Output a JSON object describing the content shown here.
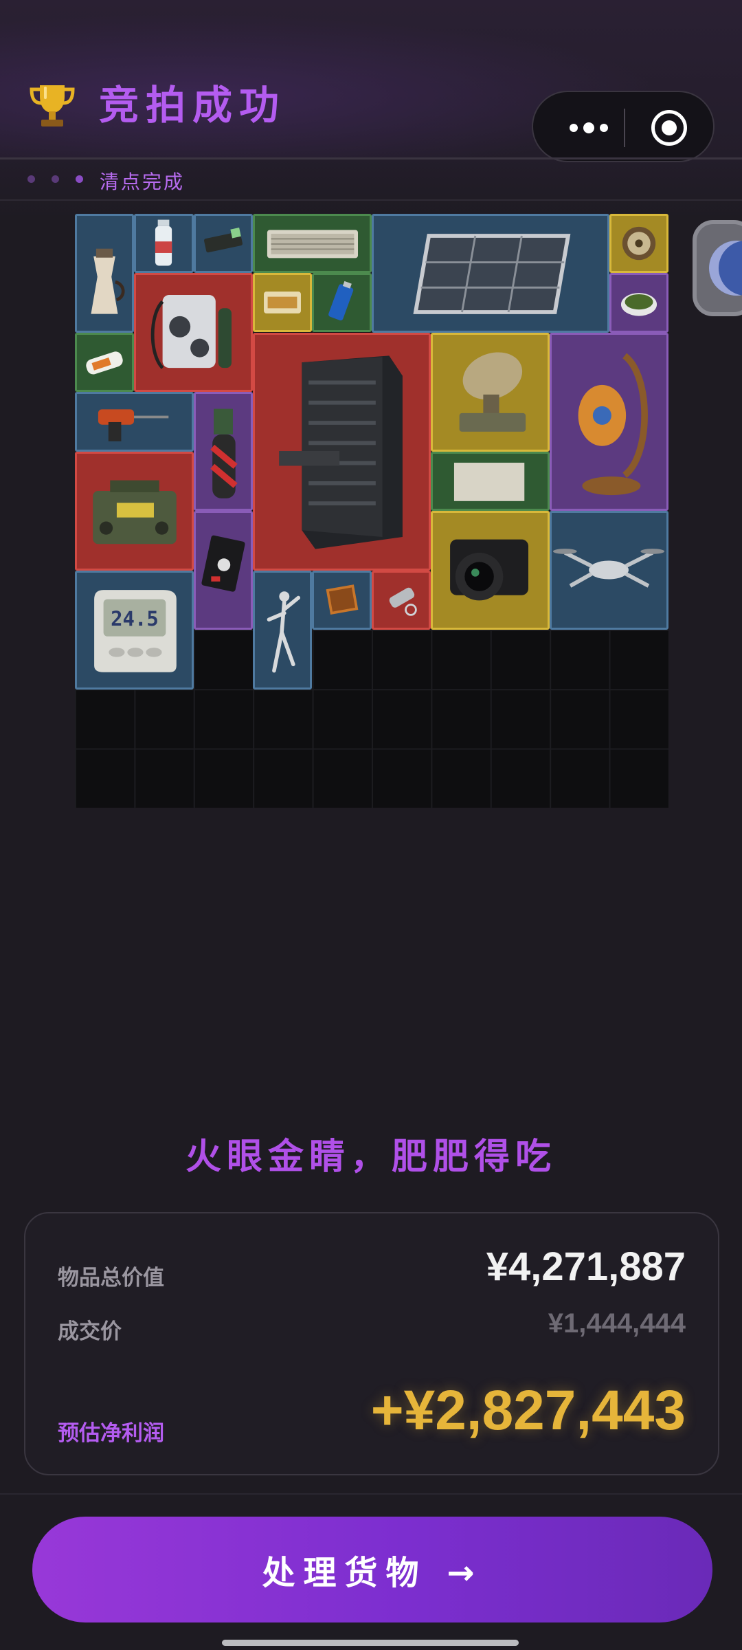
{
  "header": {
    "title": "竞拍成功",
    "status": "清点完成",
    "icons": {
      "trophy": "trophy-icon",
      "more": "more-icon",
      "target": "target-icon"
    }
  },
  "grid": {
    "items": [
      {
        "name": "moka-pot",
        "color": "blue"
      },
      {
        "name": "water-bottle",
        "color": "blue"
      },
      {
        "name": "usb-drive",
        "color": "blue"
      },
      {
        "name": "keyboard",
        "color": "green"
      },
      {
        "name": "solar-panel",
        "color": "blue"
      },
      {
        "name": "pocket-watch",
        "color": "yellow"
      },
      {
        "name": "generator",
        "color": "red"
      },
      {
        "name": "cookie-tin",
        "color": "yellow"
      },
      {
        "name": "battery",
        "color": "green"
      },
      {
        "name": "herb-bowl",
        "color": "purple"
      },
      {
        "name": "pill-bottle",
        "color": "green"
      },
      {
        "name": "server-rack",
        "color": "red"
      },
      {
        "name": "radar-dish",
        "color": "yellow"
      },
      {
        "name": "lantern",
        "color": "purple"
      },
      {
        "name": "power-drill",
        "color": "blue"
      },
      {
        "name": "blowtorch",
        "color": "purple"
      },
      {
        "name": "military-radio",
        "color": "red"
      },
      {
        "name": "old-document",
        "color": "green"
      },
      {
        "name": "snack-pack",
        "color": "purple"
      },
      {
        "name": "camera",
        "color": "yellow"
      },
      {
        "name": "drone",
        "color": "blue"
      },
      {
        "name": "thermometer",
        "color": "blue"
      },
      {
        "name": "dancer-figurine",
        "color": "blue"
      },
      {
        "name": "matchbox",
        "color": "blue"
      },
      {
        "name": "flashlight",
        "color": "red"
      }
    ],
    "thermometer_reading": "24.5"
  },
  "quote": "火眼金睛，肥肥得吃",
  "summary": {
    "total_label": "物品总价值",
    "total_value": "¥4,271,887",
    "deal_label": "成交价",
    "deal_value": "¥1,444,444",
    "profit_label": "预估净利润",
    "profit_value": "+¥2,827,443"
  },
  "cta": {
    "label": "处理货物 →"
  },
  "colors": {
    "accent": "#b45cf0",
    "profit": "#e6b53a",
    "cta": "#8a34d4",
    "blue_rarity": "#2c4a64",
    "green_rarity": "#2f5a32",
    "purple_rarity": "#5c3a80",
    "yellow_rarity": "#a48a24",
    "red_rarity": "#a0302c"
  }
}
